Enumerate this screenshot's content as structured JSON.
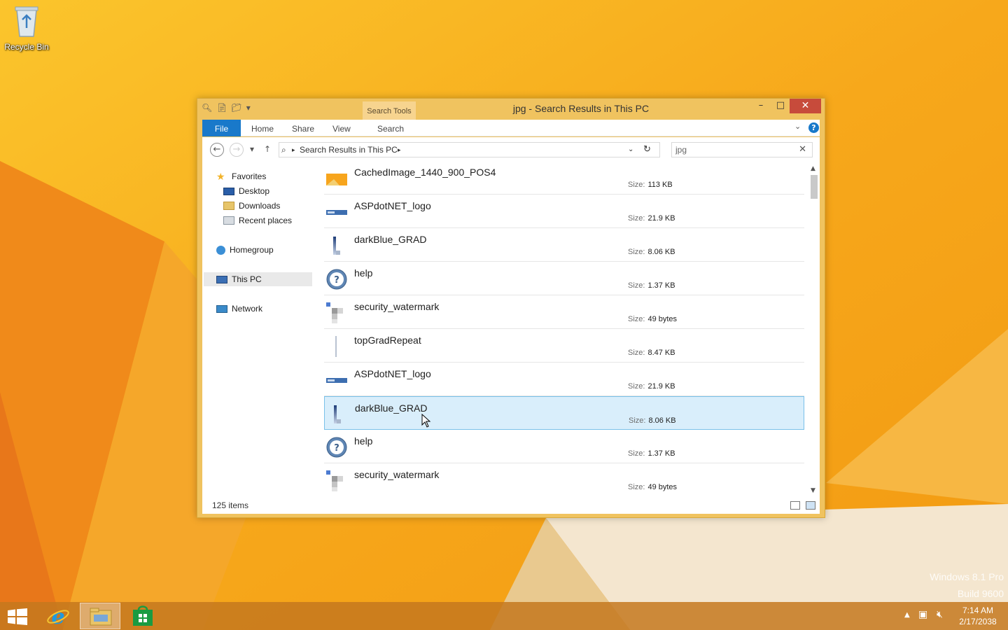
{
  "desktop": {
    "recycle_bin_label": "Recycle Bin",
    "watermark_line1": "Windows 8.1 Pro",
    "watermark_line2": "Build 9600"
  },
  "window": {
    "title": "jpg - Search Results in This PC",
    "contextual_tab": "Search Tools",
    "ribbon_tabs": [
      "File",
      "Home",
      "Share",
      "View",
      "Search"
    ],
    "address": {
      "location": "Search Results in This PC"
    },
    "search": {
      "value": "jpg"
    },
    "nav": {
      "favorites": "Favorites",
      "desktop": "Desktop",
      "downloads": "Downloads",
      "recent": "Recent places",
      "homegroup": "Homegroup",
      "this_pc": "This PC",
      "network": "Network"
    },
    "size_key": "Size:",
    "files": [
      {
        "name": "CachedImage_1440_900_POS4",
        "size": "113 KB",
        "icon": "cached-image-thumb"
      },
      {
        "name": "ASPdotNET_logo",
        "size": "21.9 KB",
        "icon": "aspnet-logo-thumb"
      },
      {
        "name": "darkBlue_GRAD",
        "size": "8.06 KB",
        "icon": "gradient-thumb"
      },
      {
        "name": "help",
        "size": "1.37 KB",
        "icon": "help-thumb"
      },
      {
        "name": "security_watermark",
        "size": "49 bytes",
        "icon": "watermark-thumb"
      },
      {
        "name": "topGradRepeat",
        "size": "8.47 KB",
        "icon": "gradient-line-thumb"
      },
      {
        "name": "ASPdotNET_logo",
        "size": "21.9 KB",
        "icon": "aspnet-logo-thumb"
      },
      {
        "name": "darkBlue_GRAD",
        "size": "8.06 KB",
        "icon": "gradient-thumb"
      },
      {
        "name": "help",
        "size": "1.37 KB",
        "icon": "help-thumb"
      },
      {
        "name": "security_watermark",
        "size": "49 bytes",
        "icon": "watermark-thumb"
      }
    ],
    "selected_index": 7,
    "status": "125 items"
  },
  "taskbar": {
    "time": "7:14 AM",
    "date": "2/17/2038"
  },
  "colors": {
    "accent": "#1979ca",
    "window_frame": "#f0c35f",
    "close_red": "#c74b3b",
    "selection": "#d9eefb"
  }
}
